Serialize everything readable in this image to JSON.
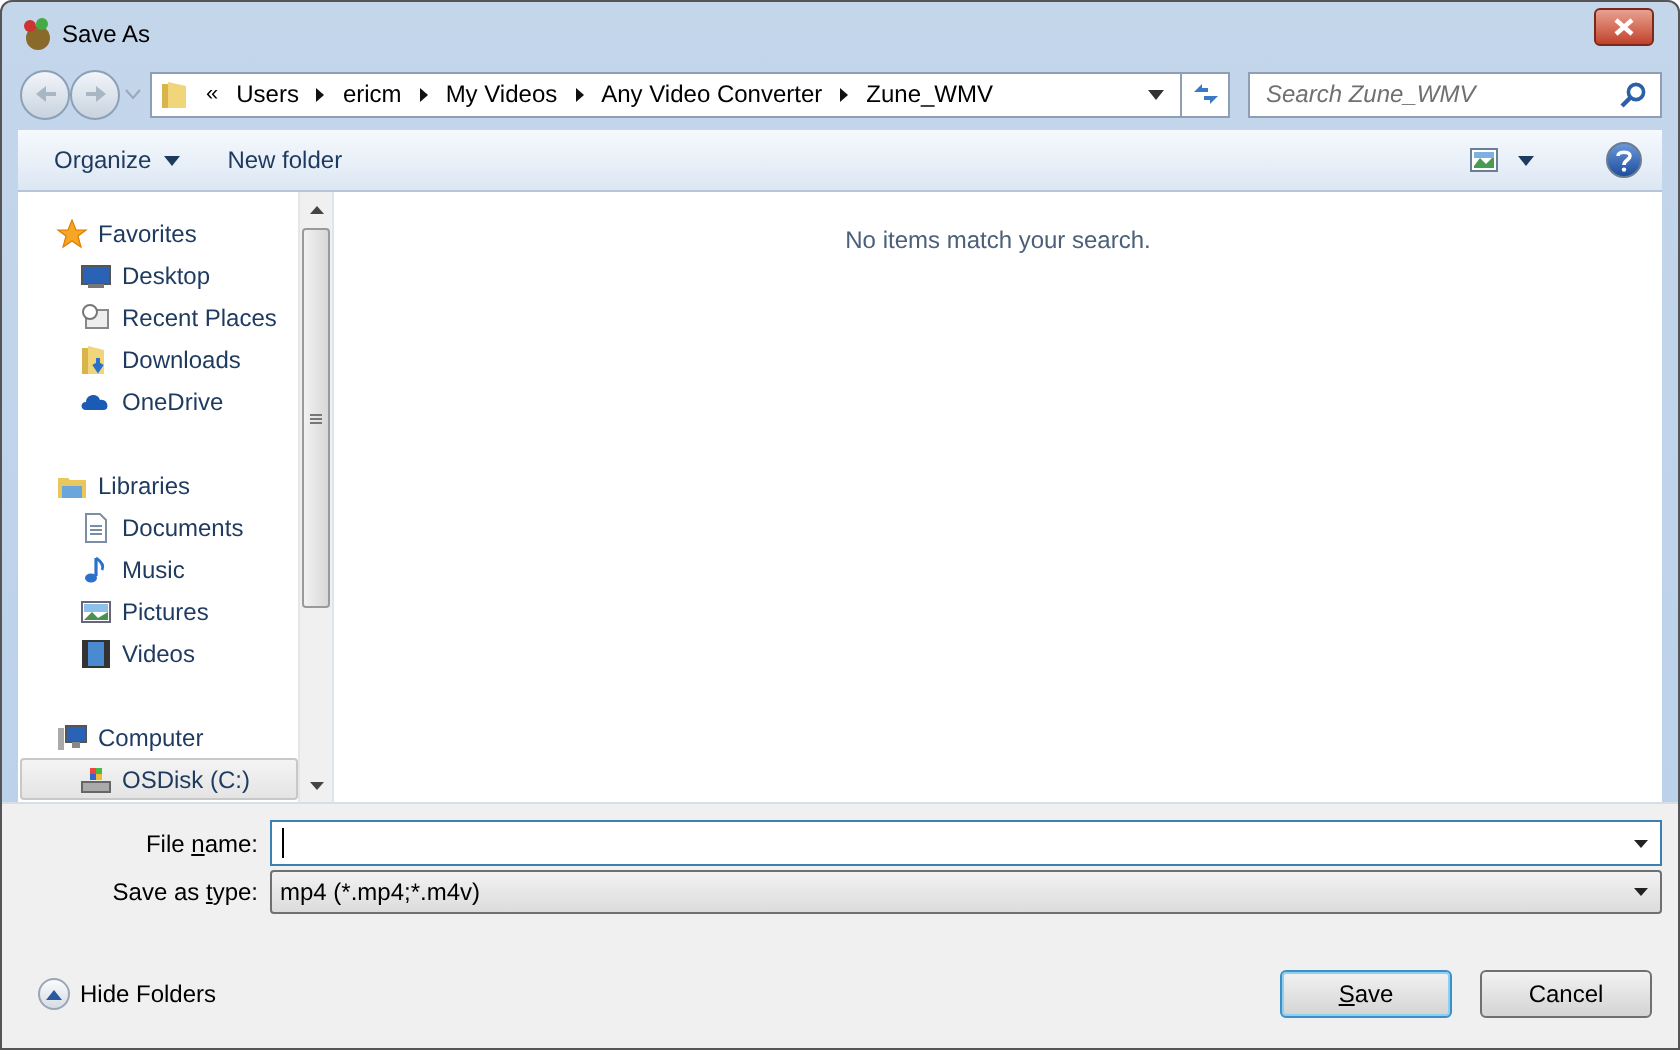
{
  "window": {
    "title": "Save As"
  },
  "address": {
    "overflow": "«",
    "crumbs": [
      "Users",
      "ericm",
      "My Videos",
      "Any Video Converter",
      "Zune_WMV"
    ]
  },
  "search": {
    "placeholder": "Search Zune_WMV"
  },
  "toolbar": {
    "buttons": [
      {
        "label": "Organize",
        "dropdown": true
      },
      {
        "label": "New folder",
        "dropdown": false
      }
    ]
  },
  "sidebar": {
    "groups": [
      {
        "label": "Favorites",
        "children": [
          {
            "label": "Desktop",
            "selected": false
          },
          {
            "label": "Recent Places",
            "selected": false
          },
          {
            "label": "Downloads",
            "selected": false
          },
          {
            "label": "OneDrive",
            "selected": false
          }
        ]
      },
      {
        "label": "Libraries",
        "children": [
          {
            "label": "Documents",
            "selected": false
          },
          {
            "label": "Music",
            "selected": false
          },
          {
            "label": "Pictures",
            "selected": false
          },
          {
            "label": "Videos",
            "selected": false
          }
        ]
      },
      {
        "label": "Computer",
        "children": [
          {
            "label": "OSDisk (C:)",
            "selected": true
          }
        ]
      }
    ]
  },
  "content": {
    "empty_message": "No items match your search."
  },
  "file_name": {
    "label": {
      "before": "File ",
      "key": "n",
      "after": "ame:"
    }
  },
  "save_as_type": {
    "label": {
      "before": "Save as ",
      "key": "t",
      "after": "ype:"
    },
    "value": "mp4 (*.mp4;*.m4v)"
  },
  "hide_folders": {
    "label": "Hide Folders"
  },
  "buttons": [
    {
      "label": {
        "key": "S",
        "after": "ave"
      },
      "default": true
    },
    {
      "label": {
        "before": "Cancel"
      },
      "default": false
    }
  ]
}
